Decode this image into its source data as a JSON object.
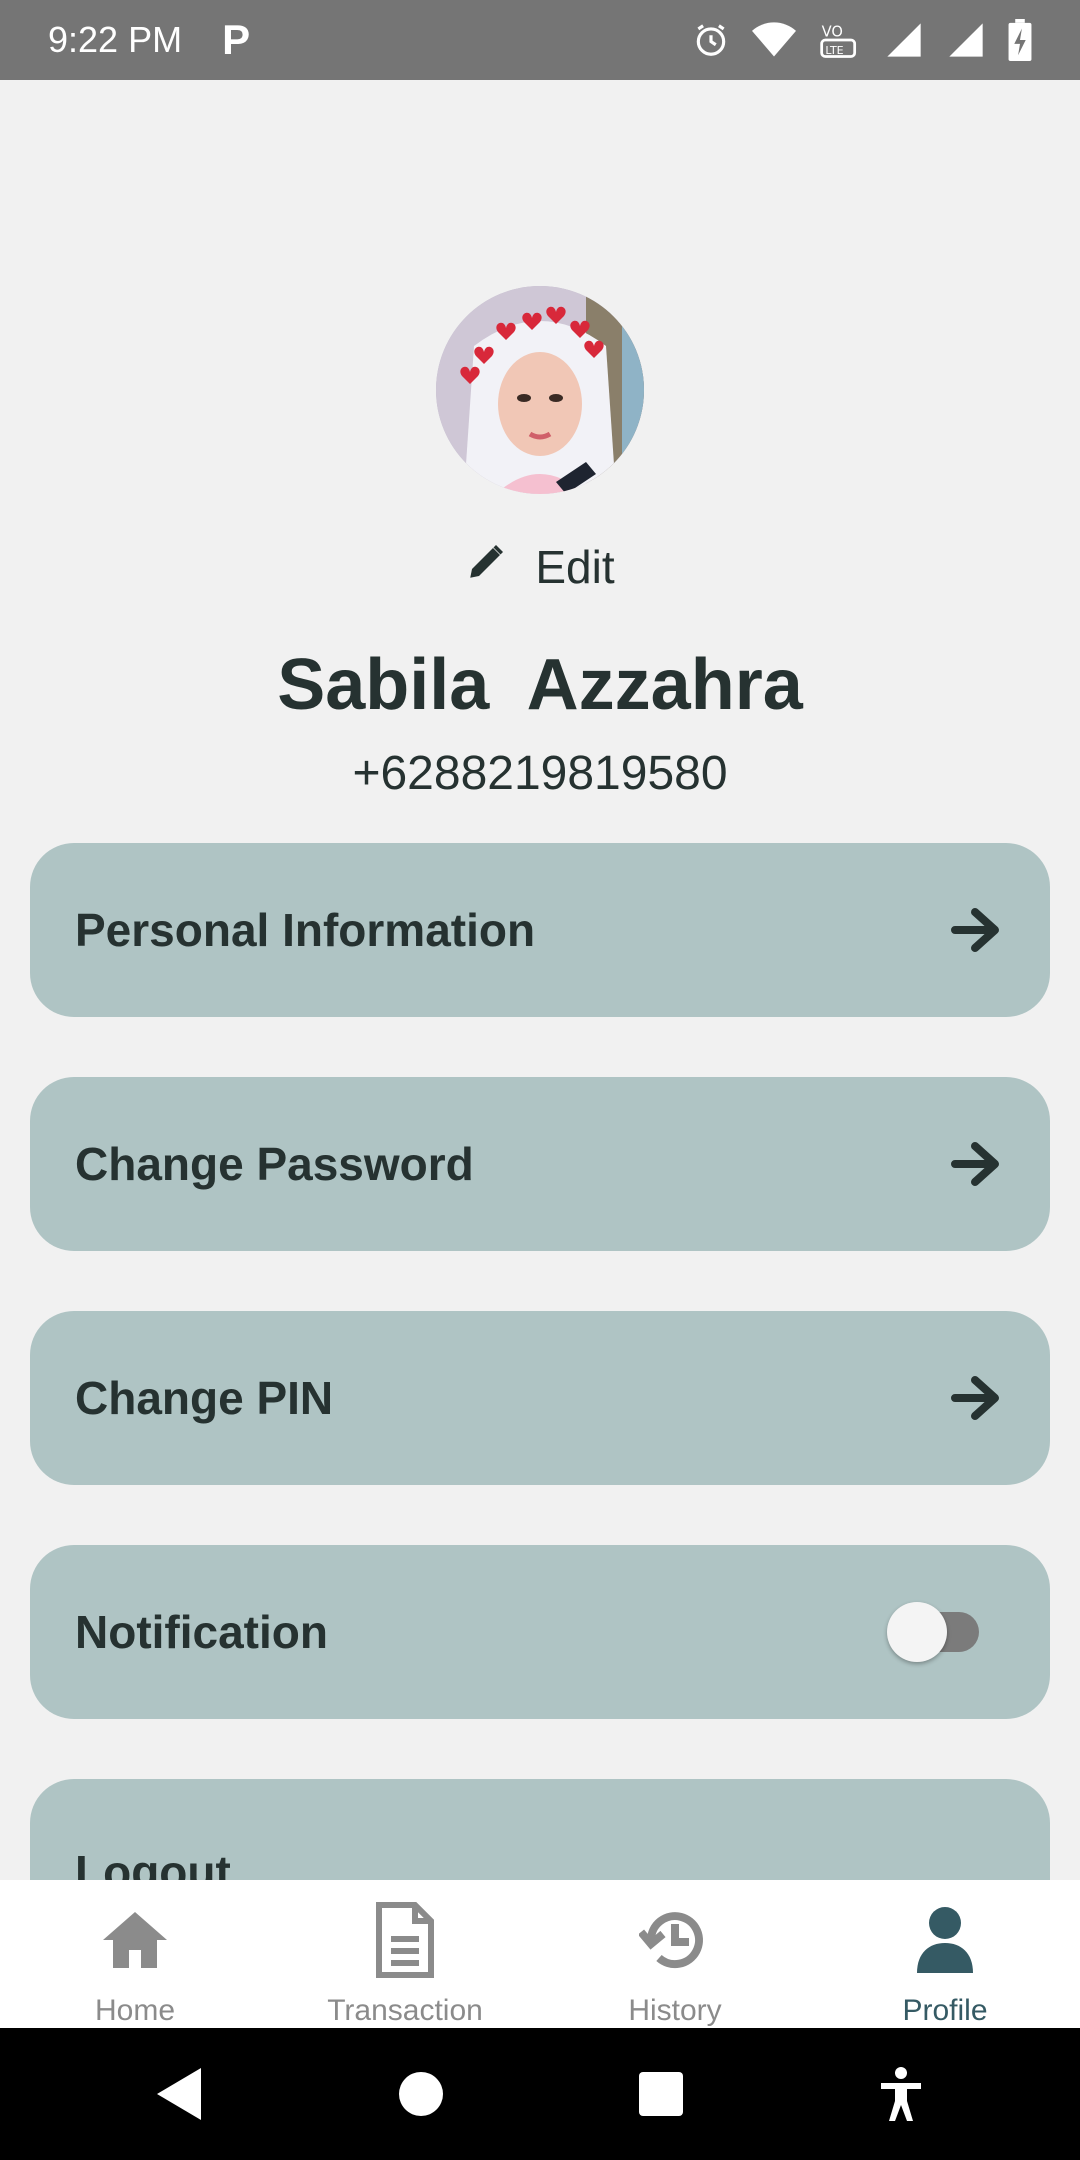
{
  "status_bar": {
    "time": "9:22 PM",
    "app_icon": "P",
    "icons": [
      "alarm-icon",
      "wifi-icon",
      "volte-icon",
      "signal-icon",
      "signal-icon",
      "battery-icon"
    ]
  },
  "profile": {
    "edit_label": "Edit",
    "name": "Sabila  Azzahra",
    "phone": "+6288219819580"
  },
  "menu": {
    "personal_info": "Personal Information",
    "change_password": "Change Password",
    "change_pin": "Change PIN",
    "notification": "Notification",
    "notification_enabled": false,
    "logout": "Logout"
  },
  "bottom_nav": {
    "home": "Home",
    "transaction": "Transaction",
    "history": "History",
    "profile": "Profile",
    "active": "profile"
  },
  "colors": {
    "background": "#f1f1f1",
    "card": "#afc4c4",
    "text": "#263231",
    "active_nav": "#355a64",
    "inactive_nav": "#8b8b8b",
    "status_bar": "#757575"
  }
}
